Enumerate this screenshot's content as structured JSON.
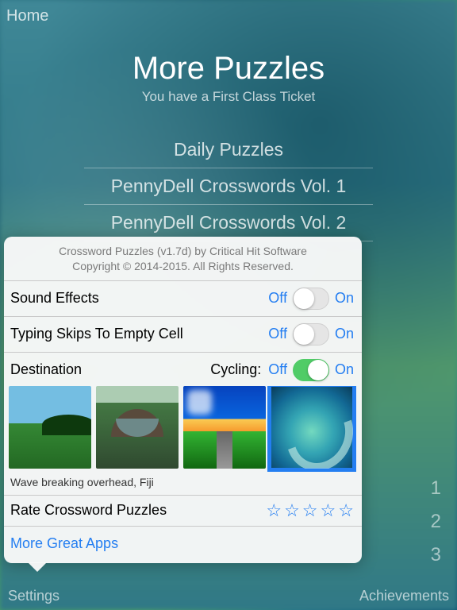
{
  "nav": {
    "home": "Home"
  },
  "page": {
    "title": "More Puzzles",
    "subtitle": "You have a First Class Ticket"
  },
  "backList": [
    "Daily Puzzles",
    "PennyDell Crosswords Vol. 1",
    "PennyDell Crosswords Vol. 2"
  ],
  "sideNumbers": [
    "1",
    "2",
    "3"
  ],
  "toolbar": {
    "settings": "Settings",
    "achievements": "Achievements"
  },
  "popover": {
    "aboutLine1": "Crossword Puzzles (v1.7d) by Critical Hit Software",
    "aboutLine2": "Copyright © 2014-2015. All Rights Reserved.",
    "soundEffects": {
      "label": "Sound Effects",
      "off": "Off",
      "on": "On",
      "value": false
    },
    "typingSkips": {
      "label": "Typing Skips To Empty Cell",
      "off": "Off",
      "on": "On",
      "value": false
    },
    "destination": {
      "label": "Destination",
      "cyclingLabel": "Cycling:",
      "off": "Off",
      "on": "On",
      "value": true,
      "caption": "Wave breaking overhead, Fiji"
    },
    "rate": {
      "label": "Rate Crossword Puzzles",
      "starCount": 5
    },
    "moreApps": "More Great Apps"
  }
}
